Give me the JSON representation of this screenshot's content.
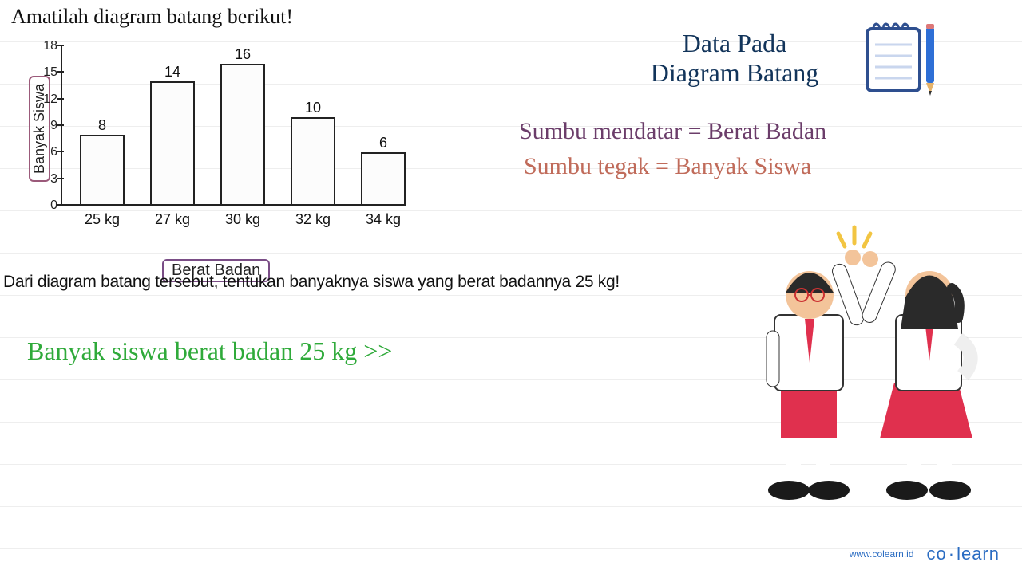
{
  "instruction": "Amatilah diagram batang berikut!",
  "chart_data": {
    "type": "bar",
    "categories": [
      "25 kg",
      "27 kg",
      "30 kg",
      "32 kg",
      "34 kg"
    ],
    "values": [
      8,
      14,
      16,
      10,
      6
    ],
    "title": "",
    "xlabel": "Berat Badan",
    "ylabel": "Banyak Siswa",
    "ylim": [
      0,
      18
    ],
    "yticks": [
      0,
      3,
      6,
      9,
      12,
      15,
      18
    ]
  },
  "question": "Dari diagram batang tersebut, tentukan banyaknya siswa yang berat badannya 25 kg!",
  "answer_prompt": "Banyak siswa berat badan 25 kg >>",
  "right": {
    "title_line1": "Data Pada",
    "title_line2": "Diagram Batang",
    "note1": "Sumbu mendatar = Berat Badan",
    "note2": "Sumbu tegak = Banyak Siswa"
  },
  "footer": {
    "url": "www.colearn.id",
    "brand_left": "co",
    "brand_right": "learn"
  },
  "icons": {
    "notepad": "notepad-pencil-icon",
    "students": "students-highfive-illustration"
  }
}
